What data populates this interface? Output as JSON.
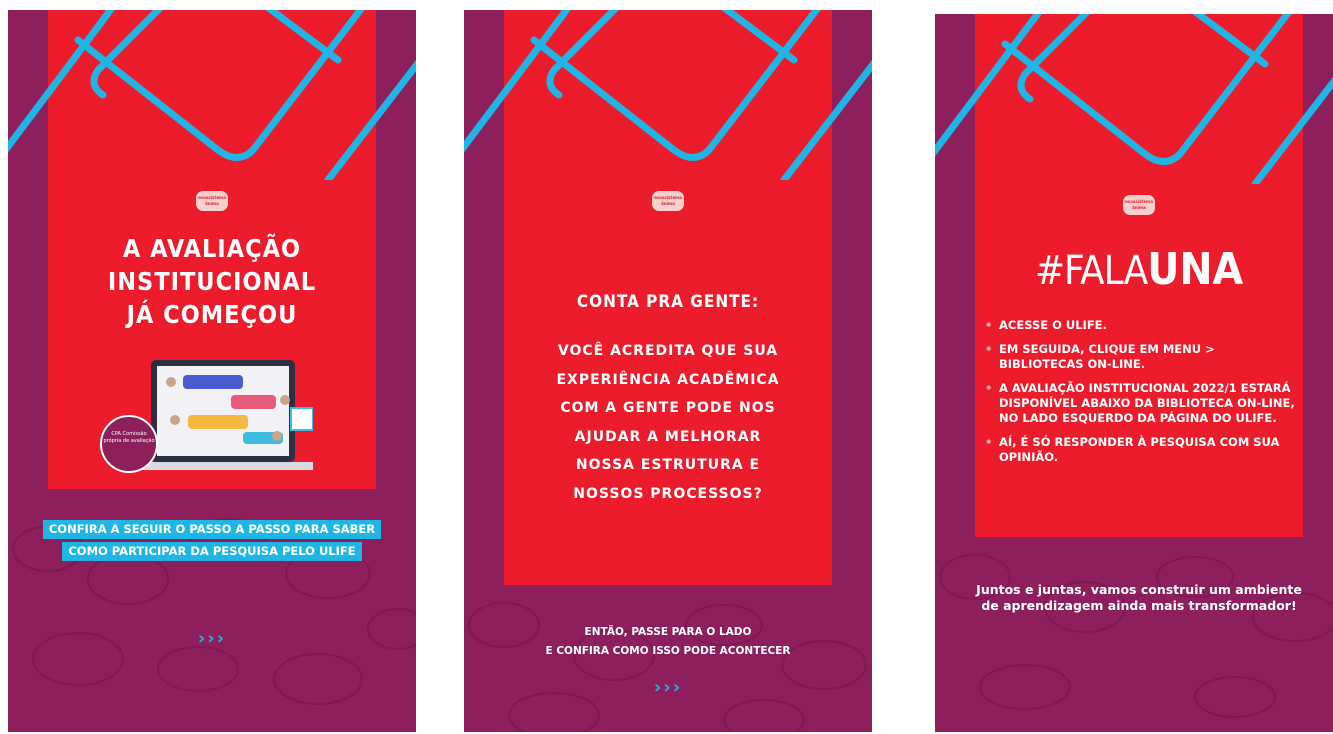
{
  "colors": {
    "purple": "#8c1f5c",
    "red": "#ec1c2d",
    "cyan": "#1fb6e6",
    "white": "#ffffff"
  },
  "logo_text": "ecossistema ânima",
  "slides": [
    {
      "headline": [
        "A AVALIAÇÃO",
        "INSTITUCIONAL",
        "JÁ COMEÇOU"
      ],
      "badge": "CPA Comissão própria de avaliação",
      "highlight": [
        "CONFIRA A SEGUIR O PASSO A PASSO PARA SABER",
        "COMO PARTICIPAR DA PESQUISA PELO ULIFE"
      ],
      "arrows": "›››",
      "arrows_icon": "chevron-right-triple-icon"
    },
    {
      "title": "CONTA PRA GENTE:",
      "body": [
        "VOCÊ ACREDITA QUE SUA",
        "EXPERIÊNCIA ACADÊMICA",
        "COM A GENTE PODE NOS",
        "AJUDAR A MELHORAR",
        "NOSSA ESTRUTURA E",
        "NOSSOS PROCESSOS?"
      ],
      "footer": [
        "ENTÃO, PASSE PARA O LADO",
        "E CONFIRA COMO ISSO PODE ACONTECER"
      ],
      "arrows": "›››",
      "arrows_icon": "chevron-right-triple-icon"
    },
    {
      "hashtag_prefix": "#FALA",
      "hashtag_bold": "UNA",
      "bullets": [
        "ACESSE O ULIFE.",
        "EM SEGUIDA, CLIQUE EM MENU > BIBLIOTECAS ON-LINE.",
        "A AVALIAÇÃO INSTITUCIONAL 2022/1 ESTARÁ DISPONÍVEL ABAIXO DA BIBLIOTECA ON-LINE, NO LADO ESQUERDO DA PÁGINA DO ULIFE.",
        "AÍ, É SÓ RESPONDER À PESQUISA COM SUA OPINIÃO."
      ],
      "closing": [
        "Juntos e juntas, vamos construir um ambiente",
        "de aprendizagem ainda mais transformador!"
      ]
    }
  ]
}
